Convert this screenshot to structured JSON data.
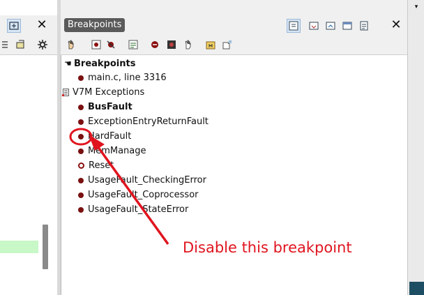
{
  "left_panel": {
    "close_label": "✕"
  },
  "breakpoints_panel": {
    "title": "Breakpoints",
    "close_label": "✕",
    "tree": {
      "root_label": "Breakpoints",
      "breakpoint_1": "main.c, line 3316",
      "group_label": "V7M Exceptions",
      "exceptions": [
        "BusFault",
        "ExceptionEntryReturnFault",
        "HardFault",
        "MemManage",
        "Reset",
        "UsageFault_CheckingError",
        "UsageFault_Coprocessor",
        "UsageFault_StateError"
      ]
    }
  },
  "annotation": {
    "text": "Disable this breakpoint",
    "color": "#e0141e"
  },
  "colors": {
    "breakpoint_dot": "#7a1010",
    "title_bg": "#5a5a5a",
    "panel_bg": "#ffffff",
    "chrome_bg": "#f0f0f0"
  }
}
